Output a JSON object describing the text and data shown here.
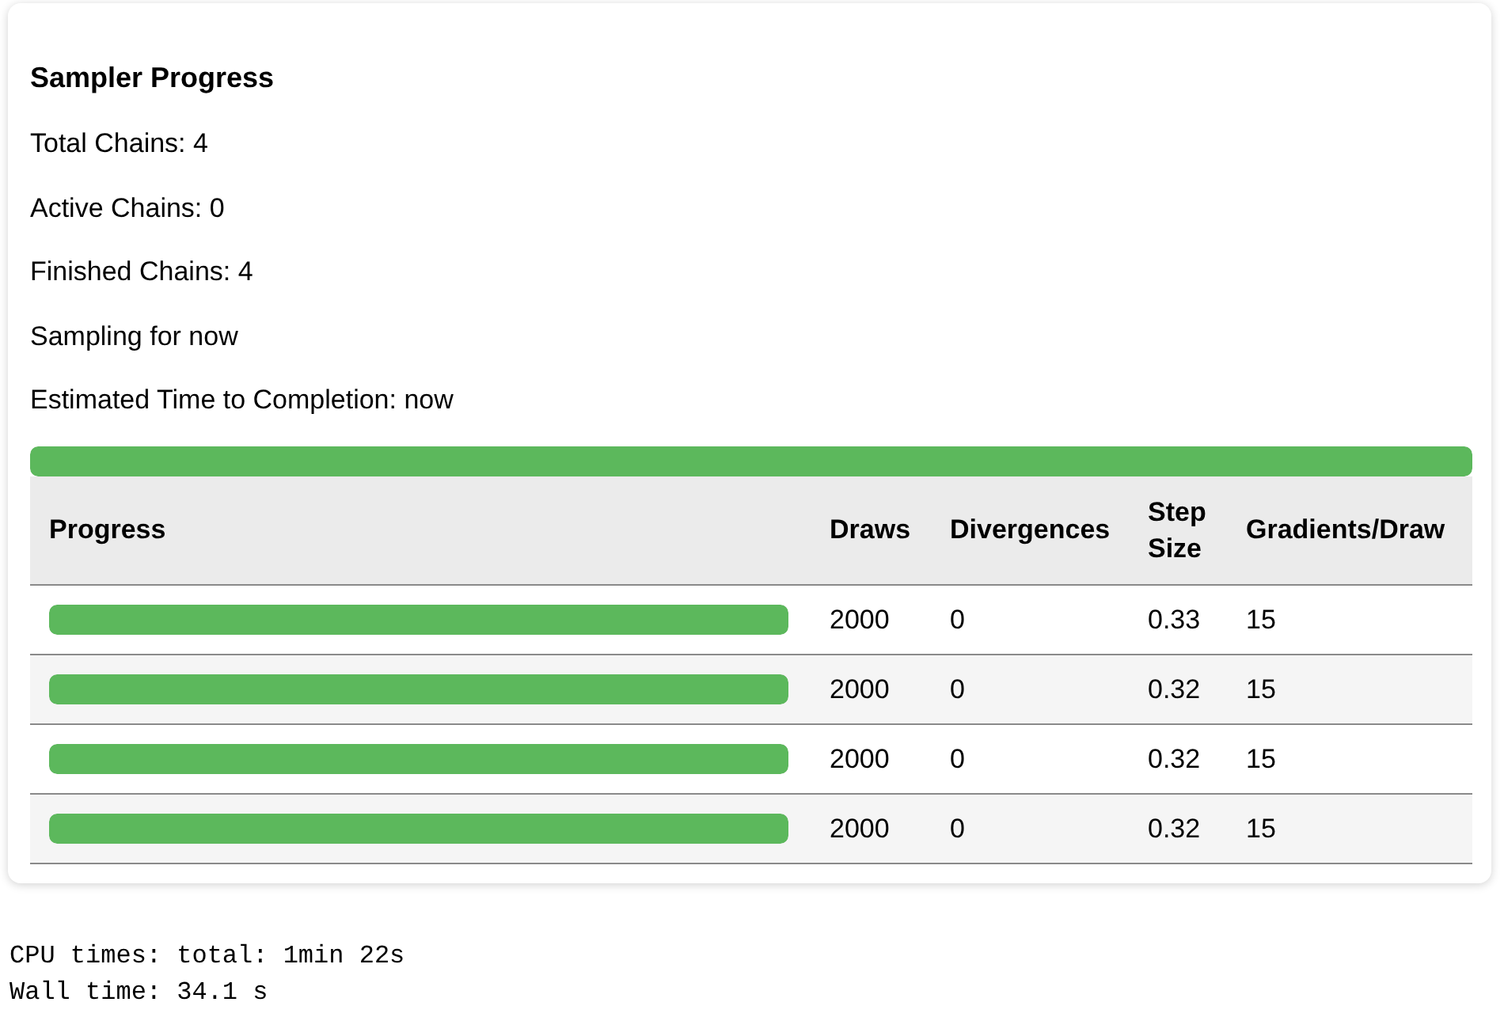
{
  "panel": {
    "title": "Sampler Progress",
    "stats": [
      "Total Chains: 4",
      "Active Chains: 0",
      "Finished Chains: 4",
      "Sampling for now",
      "Estimated Time to Completion: now"
    ],
    "overall_progress": {
      "level": 1
    },
    "table": {
      "columns": [
        "Progress",
        "Draws",
        "Divergences",
        "Step Size",
        "Gradients/Draw"
      ],
      "rows": [
        {
          "level": 1,
          "draws": "2000",
          "divergences": "0",
          "step_size": "0.33",
          "gradients_per_draw": "15"
        },
        {
          "level": 1,
          "draws": "2000",
          "divergences": "0",
          "step_size": "0.32",
          "gradients_per_draw": "15"
        },
        {
          "level": 1,
          "draws": "2000",
          "divergences": "0",
          "step_size": "0.32",
          "gradients_per_draw": "15"
        },
        {
          "level": 1,
          "draws": "2000",
          "divergences": "0",
          "step_size": "0.32",
          "gradients_per_draw": "15"
        }
      ]
    }
  },
  "output": [
    "CPU times: total: 1min 22s",
    "Wall time: 34.1 s"
  ]
}
